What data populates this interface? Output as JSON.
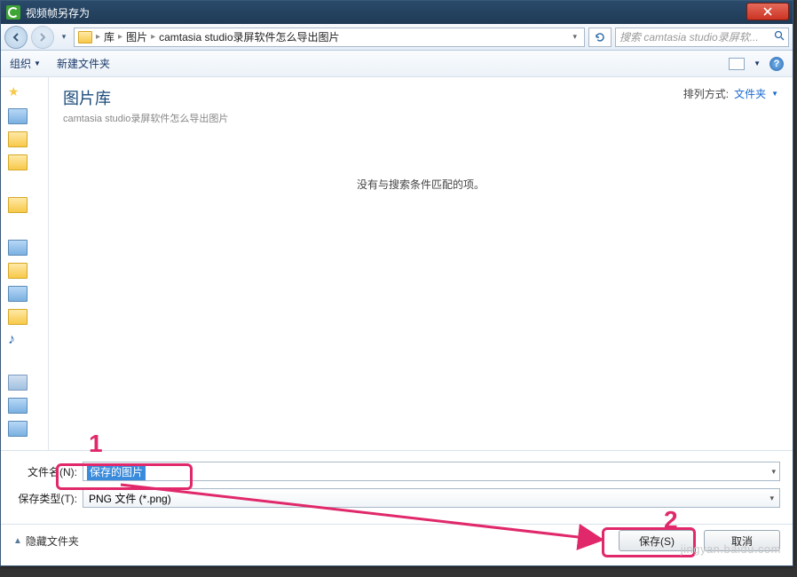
{
  "titlebar": {
    "title": "视频帧另存为"
  },
  "breadcrumb": {
    "root": "库",
    "item1": "图片",
    "item2": "camtasia studio录屏软件怎么导出图片"
  },
  "search": {
    "placeholder": "搜索 camtasia studio录屏软..."
  },
  "toolbar": {
    "organize": "组织",
    "newfolder": "新建文件夹"
  },
  "content": {
    "lib_title": "图片库",
    "lib_sub": "camtasia studio录屏软件怎么导出图片",
    "sort_label": "排列方式:",
    "sort_value": "文件夹",
    "empty": "没有与搜索条件匹配的项。"
  },
  "fields": {
    "filename_label": "文件名(N):",
    "filename_value": "保存的图片",
    "filetype_label": "保存类型(T):",
    "filetype_value": "PNG 文件 (*.png)"
  },
  "actions": {
    "hide_folders": "隐藏文件夹",
    "save": "保存(S)",
    "cancel": "取消"
  },
  "annotations": {
    "one": "1",
    "two": "2"
  },
  "watermark": "jingyan.baidu.com"
}
